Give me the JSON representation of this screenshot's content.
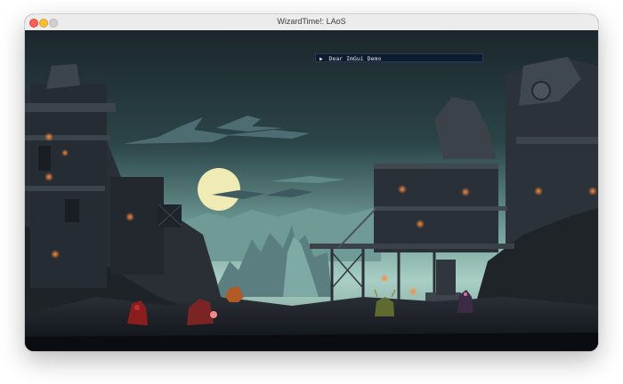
{
  "window": {
    "title": "WizardTime!: LAoS",
    "controls": [
      "close",
      "minimize",
      "maximize"
    ]
  },
  "imgui": {
    "collapse_icon": "triangle-right-icon",
    "title": "Dear ImGui Demo"
  },
  "scene": {
    "description_icons": [
      "moon",
      "clouds",
      "ruined-towers",
      "scaffold-house",
      "mountains"
    ],
    "characters": [
      {
        "name": "red-hooded-figure"
      },
      {
        "name": "red-bear-creature"
      },
      {
        "name": "orange-lantern-creature"
      },
      {
        "name": "green-horned-creature"
      },
      {
        "name": "purple-cloaked-figure"
      }
    ]
  },
  "colors": {
    "sky_top": "#1d2a30",
    "sky_horizon": "#9fc7bd",
    "moon": "#f0ebb4",
    "window_glow": "#ff6a2b"
  }
}
